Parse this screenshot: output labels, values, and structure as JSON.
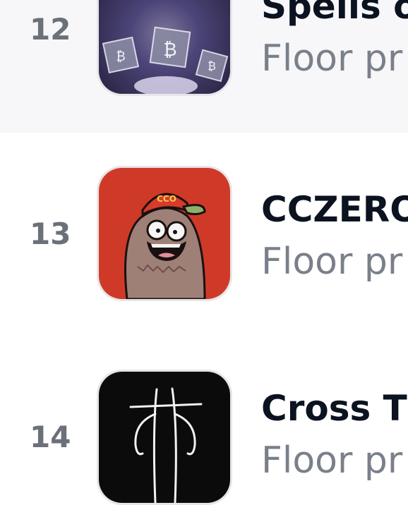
{
  "collections": [
    {
      "rank": "12",
      "name": "Spells o",
      "floor_label": "Floor pr",
      "image": "hooded-wizard-crypto-cubes"
    },
    {
      "rank": "13",
      "name": "CCZERO",
      "floor_label": "Floor pr",
      "image": "cartoon-creature-cap",
      "cap_text": "CCO",
      "colors": {
        "bg": "#cf3a28",
        "body": "#9e8077"
      }
    },
    {
      "rank": "14",
      "name": "Cross T",
      "floor_label": "Floor pr",
      "image": "white-line-figure-black"
    }
  ]
}
